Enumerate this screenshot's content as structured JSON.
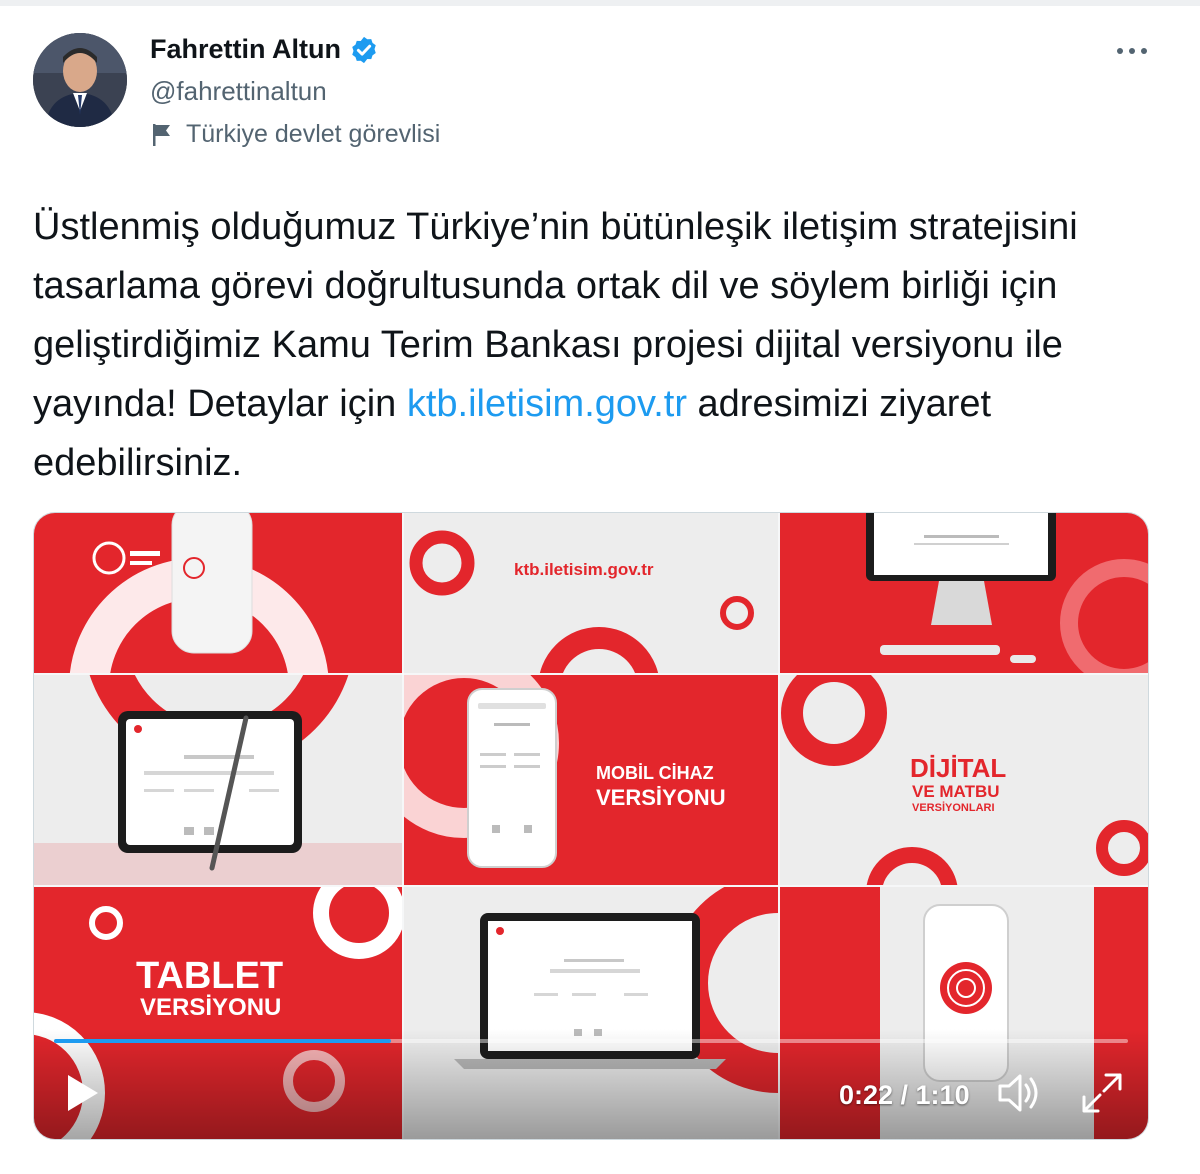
{
  "author": {
    "display_name": "Fahrettin Altun",
    "handle": "@fahrettinaltun",
    "label": "Türkiye devlet görevlisi",
    "verified_icon": "verified-badge-icon",
    "label_icon": "flag-icon"
  },
  "tweet": {
    "text_before_link": "Üstlenmiş olduğumuz Türkiye’nin bütünleşik iletişim stratejisini tasarlama görevi doğrultusunda ortak dil ve söylem birliği için geliştirdiğimiz Kamu Terim Bankası projesi dijital versiyonu ile yayında! Detaylar için ",
    "link_text": "ktb.iletisim.gov.tr",
    "text_after_link": " adresimizi ziyaret edebilirsiniz."
  },
  "video": {
    "frame_texts": {
      "url": "ktb.iletisim.gov.tr",
      "mobile_line1": "MOBİL CİHAZ",
      "mobile_line2": "VERSİYONU",
      "digital_line1": "DİJİTAL",
      "digital_line2": "VE MATBU",
      "digital_line3": "VERSİYONLARI",
      "tablet_line1": "TABLET",
      "tablet_line2": "VERSİYONU"
    },
    "current_time": "0:22",
    "duration": "1:10",
    "time_display": "0:22 / 1:10",
    "progress": 0.314
  },
  "colors": {
    "accent": "#1d9bf0",
    "brand_red": "#e3262c",
    "panel_grey": "#ededed"
  }
}
